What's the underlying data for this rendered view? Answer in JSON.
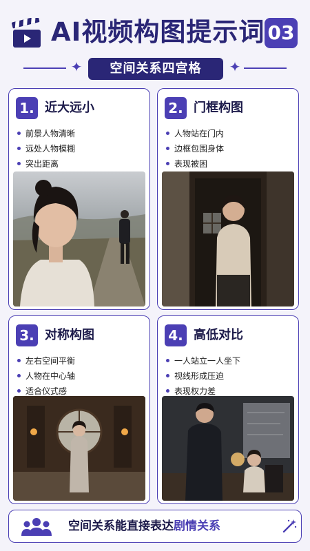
{
  "header": {
    "title": "AI视频构图提示词",
    "number": "03",
    "subtitle": "空间关系四宫格"
  },
  "cards": [
    {
      "number": "1.",
      "title": "近大远小",
      "bullets": [
        "前景人物清晰",
        "远处人物模糊",
        "突出距离"
      ]
    },
    {
      "number": "2.",
      "title": "门框构图",
      "bullets": [
        "人物站在门内",
        "边框包围身体",
        "表现被困"
      ]
    },
    {
      "number": "3.",
      "title": "对称构图",
      "bullets": [
        "左右空间平衡",
        "人物在中心轴",
        "适合仪式感"
      ]
    },
    {
      "number": "4.",
      "title": "高低对比",
      "bullets": [
        "一人站立一人坐下",
        "视线形成压迫",
        "表现权力差"
      ]
    }
  ],
  "footer": {
    "text_main": "空间关系能直接表达",
    "text_accent": "剧情关系"
  },
  "colors": {
    "accent": "#4b3fb4",
    "navy": "#2a2676",
    "background": "#f4f3fa"
  },
  "icons": {
    "header": "clapperboard-icon",
    "header_decor": "sparkle-icon",
    "footer_left": "people-group-icon",
    "footer_right": "magic-wand-icon"
  }
}
